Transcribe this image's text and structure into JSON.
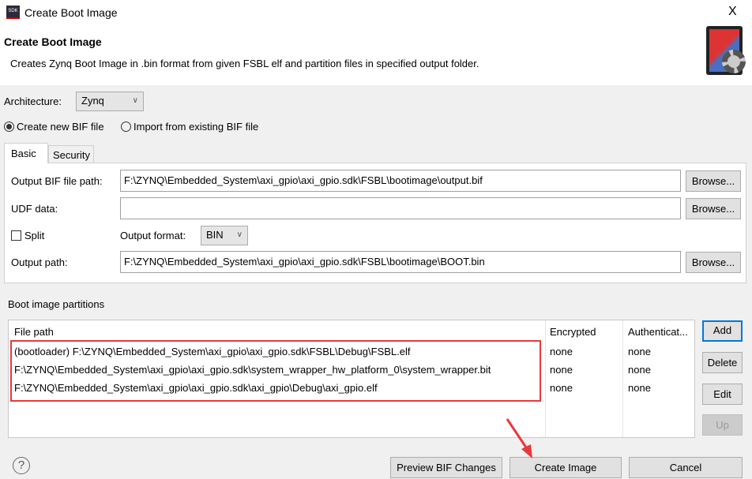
{
  "window": {
    "title": "Create Boot Image",
    "app_icon_label": "SDK",
    "close": "X"
  },
  "header": {
    "title": "Create Boot Image",
    "description": "Creates Zynq Boot Image in .bin format from given FSBL elf and partition files in specified output folder."
  },
  "architecture": {
    "label": "Architecture:",
    "value": "Zynq"
  },
  "bif_mode": {
    "create_label": "Create new BIF file",
    "import_label": "Import from existing BIF file",
    "selected": "create"
  },
  "tabs": [
    {
      "label": "Basic",
      "active": true
    },
    {
      "label": "Security",
      "active": false
    }
  ],
  "basic": {
    "output_bif_label": "Output BIF file path:",
    "output_bif_value": "F:\\ZYNQ\\Embedded_System\\axi_gpio\\axi_gpio.sdk\\FSBL\\bootimage\\output.bif",
    "udf_label": "UDF data:",
    "udf_value": "",
    "split_label": "Split",
    "split_checked": false,
    "output_format_label": "Output format:",
    "output_format_value": "BIN",
    "output_path_label": "Output path:",
    "output_path_value": "F:\\ZYNQ\\Embedded_System\\axi_gpio\\axi_gpio.sdk\\FSBL\\bootimage\\BOOT.bin",
    "browse": "Browse..."
  },
  "partitions": {
    "title": "Boot image partitions",
    "columns": [
      "File path",
      "Encrypted",
      "Authenticat..."
    ],
    "rows": [
      [
        "(bootloader) F:\\ZYNQ\\Embedded_System\\axi_gpio\\axi_gpio.sdk\\FSBL\\Debug\\FSBL.elf",
        "none",
        "none"
      ],
      [
        "F:\\ZYNQ\\Embedded_System\\axi_gpio\\axi_gpio.sdk\\system_wrapper_hw_platform_0\\system_wrapper.bit",
        "none",
        "none"
      ],
      [
        "F:\\ZYNQ\\Embedded_System\\axi_gpio\\axi_gpio.sdk\\axi_gpio\\Debug\\axi_gpio.elf",
        "none",
        "none"
      ]
    ],
    "buttons": {
      "add": "Add",
      "delete": "Delete",
      "edit": "Edit",
      "up": "Up"
    }
  },
  "footer": {
    "help": "?",
    "preview": "Preview BIF Changes",
    "create": "Create Image",
    "cancel": "Cancel"
  },
  "colors": {
    "highlight": "#e8393b",
    "focus": "#0078d7"
  }
}
